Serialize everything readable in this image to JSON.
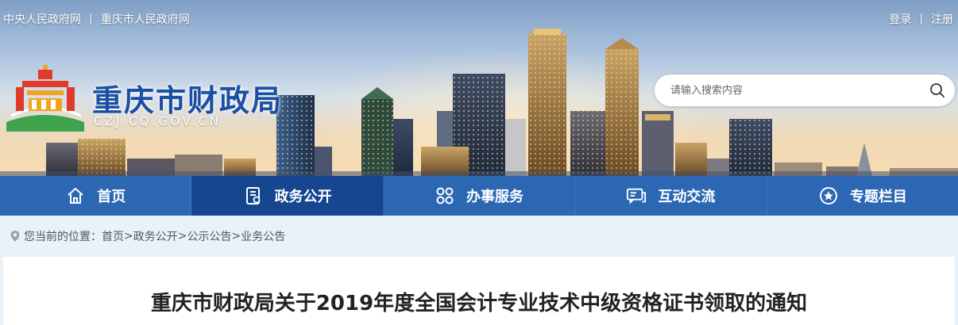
{
  "top_links": {
    "gov_central": "中央人民政府网",
    "gov_city": "重庆市人民政府网",
    "separator": "|",
    "login": "登录",
    "register": "注册"
  },
  "site": {
    "title": "重庆市财政局",
    "domain": "CZJ.CQ.GOV.CN"
  },
  "search": {
    "placeholder": "请输入搜索内容",
    "icon": "search-icon"
  },
  "nav": {
    "items": [
      {
        "label": "首页",
        "icon": "home-icon",
        "active": false
      },
      {
        "label": "政务公开",
        "icon": "document-icon",
        "active": true
      },
      {
        "label": "办事服务",
        "icon": "grid-icon",
        "active": false
      },
      {
        "label": "互动交流",
        "icon": "chat-icon",
        "active": false
      },
      {
        "label": "专题栏目",
        "icon": "star-icon",
        "active": false
      }
    ]
  },
  "breadcrumb": {
    "prefix": "您当前的位置：",
    "items": [
      "首页",
      "政务公开",
      "公示公告",
      "业务公告"
    ],
    "separator": ">"
  },
  "article": {
    "title": "重庆市财政局关于2019年度全国会计专业技术中级资格证书领取的通知"
  },
  "colors": {
    "nav_bg": "#2b67b3",
    "nav_active": "#15468f",
    "title_blue": "#1a4fa3",
    "page_bg": "#e9f1f9"
  }
}
